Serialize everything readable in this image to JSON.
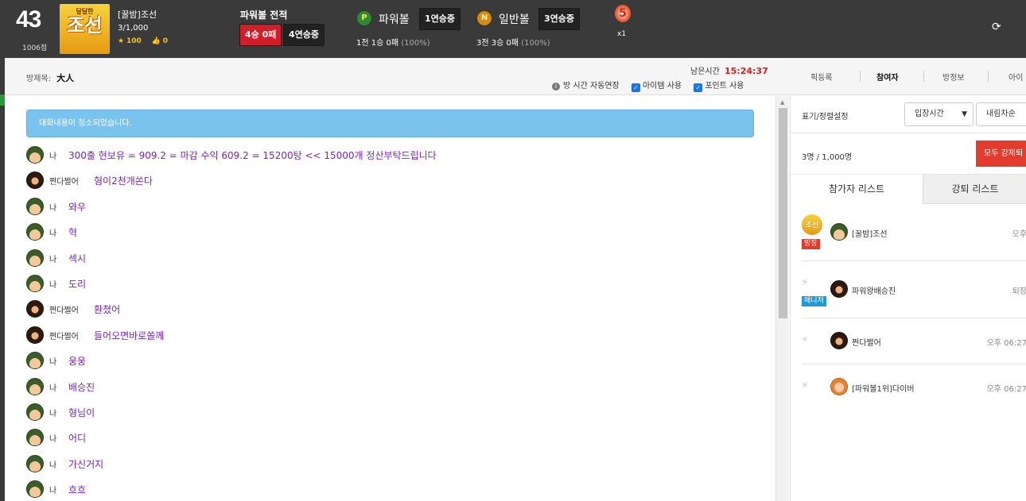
{
  "header": {
    "level": "43",
    "points": "1006점",
    "logo_top": "달달한",
    "logo_main": "조선",
    "logo_bottom": "",
    "user_name": "[꿀밤]조선",
    "user_count": "3/1,000",
    "stars": "100",
    "likes": "0",
    "powerball_title": "파워볼 전적",
    "record_badge": "4승 0패",
    "streak_badge": "4연승중",
    "pball": {
      "icon": "P",
      "label": "파워볼",
      "streak": "1연승중",
      "record": "1전 1승 0패",
      "pct": "(100%)"
    },
    "nball": {
      "icon": "N",
      "label": "일반볼",
      "streak": "3연승중",
      "record": "3전 3승 0패",
      "pct": "(100%)"
    },
    "medal": "5",
    "medal_mult": "x1"
  },
  "subheader": {
    "room_title_label": "방제목:",
    "room_title": "大人",
    "remain_label": "남은시간",
    "remain_time": "15:24:37",
    "auto_extend": "방 시간 자동연장",
    "item_use": "아이템 사용",
    "point_use": "포인트 사용",
    "tabs": [
      "픽등록",
      "참여자",
      "방정보",
      "아이"
    ]
  },
  "chat": {
    "notice": "대화내용이 청소되었습니다.",
    "messages": [
      {
        "name": "나",
        "text": "300출 현보유 = 909.2 = 마감 수익 609.2 = 15200탕 << 15000개 정산부탁드립니다",
        "avatar": "army"
      },
      {
        "name": "쩐다쩔어",
        "text": "형이2천개쏜다",
        "avatar": "sun"
      },
      {
        "name": "나",
        "text": "와우",
        "avatar": "army"
      },
      {
        "name": "나",
        "text": "혁",
        "avatar": "army"
      },
      {
        "name": "나",
        "text": "섹시",
        "avatar": "army"
      },
      {
        "name": "나",
        "text": "도리",
        "avatar": "army"
      },
      {
        "name": "쩐다쩔어",
        "text": "환쳤어",
        "avatar": "sun"
      },
      {
        "name": "쩐다쩔어",
        "text": "들어오면바로쏠께",
        "avatar": "sun"
      },
      {
        "name": "나",
        "text": "웅웅",
        "avatar": "army"
      },
      {
        "name": "나",
        "text": "배승진",
        "avatar": "army"
      },
      {
        "name": "나",
        "text": "형님이",
        "avatar": "army"
      },
      {
        "name": "나",
        "text": "어디",
        "avatar": "army"
      },
      {
        "name": "나",
        "text": "가신거지",
        "avatar": "army"
      },
      {
        "name": "나",
        "text": "흐흐",
        "avatar": "army"
      }
    ]
  },
  "panel": {
    "sort_label": "표기/정렬설정",
    "sort_select": "입장시간",
    "order_select": "내림차순",
    "count": "3명 / 1,000명",
    "kick_all": "모두 강제퇴",
    "tab_participants": "참가자 리스트",
    "tab_kicked": "강퇴 리스트",
    "participants": [
      {
        "name": "[꿀밤]조선",
        "time": "오후",
        "tag": "방장",
        "logo": "조선",
        "avatar": "army"
      },
      {
        "name": "파워왕배승진",
        "time": "퇴장",
        "tag": "매니저",
        "avatar": "sun"
      },
      {
        "name": "쩐다쩔어",
        "time": "오후 06:27",
        "tag": "",
        "avatar": "sun"
      },
      {
        "name": "[파워볼1위]다이버",
        "time": "오후 06:27",
        "tag": "",
        "avatar": "pig"
      }
    ]
  }
}
